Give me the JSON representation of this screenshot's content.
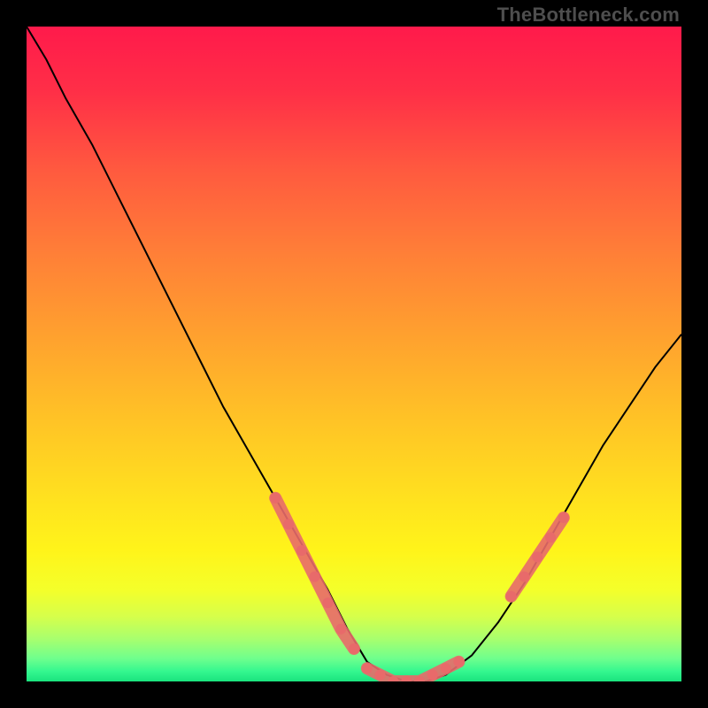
{
  "watermark": "TheBottleneck.com",
  "gradient": {
    "stops": [
      {
        "offset": 0.0,
        "color": "#ff1a4b"
      },
      {
        "offset": 0.1,
        "color": "#ff2f47"
      },
      {
        "offset": 0.22,
        "color": "#ff5a3f"
      },
      {
        "offset": 0.35,
        "color": "#ff8037"
      },
      {
        "offset": 0.48,
        "color": "#ffa32e"
      },
      {
        "offset": 0.6,
        "color": "#ffc326"
      },
      {
        "offset": 0.72,
        "color": "#ffe11f"
      },
      {
        "offset": 0.8,
        "color": "#fff41a"
      },
      {
        "offset": 0.86,
        "color": "#f4ff2a"
      },
      {
        "offset": 0.9,
        "color": "#d7ff4a"
      },
      {
        "offset": 0.935,
        "color": "#a8ff6e"
      },
      {
        "offset": 0.965,
        "color": "#6fff8d"
      },
      {
        "offset": 0.985,
        "color": "#33f78f"
      },
      {
        "offset": 1.0,
        "color": "#1ae37e"
      }
    ]
  },
  "chart_data": {
    "type": "line",
    "title": "",
    "xlabel": "",
    "ylabel": "",
    "x_range": [
      0,
      100
    ],
    "y_range": [
      0,
      100
    ],
    "series": [
      {
        "name": "bottleneck-curve",
        "stroke": "#000000",
        "x": [
          0,
          3,
          6,
          10,
          14,
          18,
          22,
          26,
          30,
          34,
          38,
          42,
          46,
          49,
          52,
          55,
          58,
          61,
          64,
          68,
          72,
          76,
          80,
          84,
          88,
          92,
          96,
          100
        ],
        "y": [
          100,
          95,
          89,
          82,
          74,
          66,
          58,
          50,
          42,
          35,
          28,
          21,
          14,
          8,
          3,
          1,
          0,
          0,
          1,
          4,
          9,
          15,
          22,
          29,
          36,
          42,
          48,
          53
        ]
      }
    ],
    "marker_segments": [
      {
        "name": "left-band",
        "color": "#e86a6a",
        "x": [
          38,
          40,
          42,
          44,
          46,
          48,
          50
        ],
        "y": [
          28,
          24,
          20,
          16,
          12,
          8,
          5
        ]
      },
      {
        "name": "valley-band",
        "color": "#e86a6a",
        "x": [
          52,
          54,
          56,
          58,
          60,
          62,
          64,
          66
        ],
        "y": [
          2,
          1,
          0,
          0,
          0,
          1,
          2,
          3
        ]
      },
      {
        "name": "right-band",
        "color": "#e86a6a",
        "x": [
          74,
          76,
          78,
          80,
          82
        ],
        "y": [
          13,
          16,
          19,
          22,
          25
        ]
      }
    ]
  }
}
